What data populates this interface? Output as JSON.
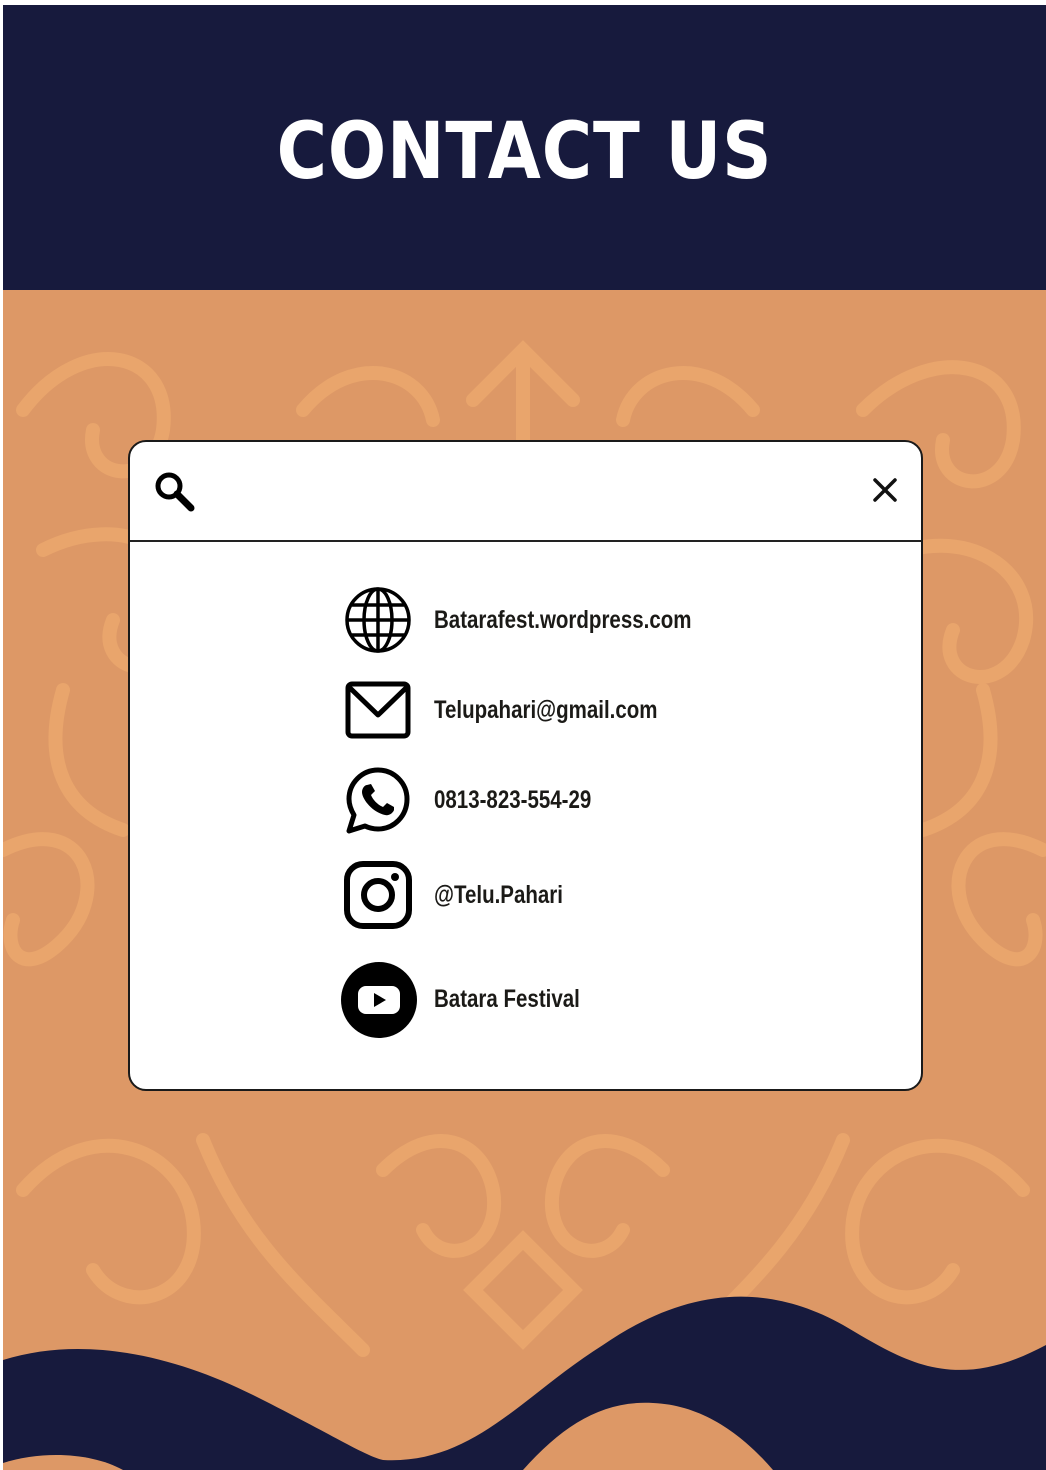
{
  "page": {
    "title": "CONTACT US"
  },
  "search": {
    "placeholder": "",
    "value": "",
    "search_icon": "search-icon",
    "close_icon": "close-icon"
  },
  "contacts": [
    {
      "icon": "globe-icon",
      "label": "Batarafest.wordpress.com"
    },
    {
      "icon": "mail-icon",
      "label": "Telupahari@gmail.com"
    },
    {
      "icon": "whatsapp-icon",
      "label": "0813-823-554-29"
    },
    {
      "icon": "instagram-icon",
      "label": "@Telu.Pahari"
    },
    {
      "icon": "youtube-icon",
      "label": "Batara Festival"
    }
  ],
  "colors": {
    "navy": "#171A3D",
    "orange": "#DD9866",
    "ornament": "#EDAA6E",
    "card": "#FFFFFF",
    "text": "#1B1A17"
  }
}
